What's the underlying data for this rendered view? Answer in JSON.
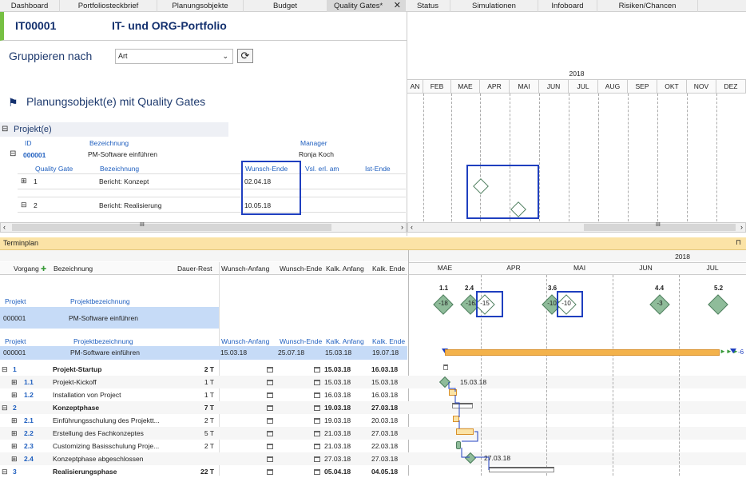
{
  "tabs": [
    {
      "label": "Dashboard"
    },
    {
      "label": "Portfoliosteckbrief"
    },
    {
      "label": "Planungsobjekte"
    },
    {
      "label": "Budget"
    },
    {
      "label": "Quality Gates*"
    },
    {
      "label": "Status"
    },
    {
      "label": "Simulationen"
    },
    {
      "label": "Infoboard"
    },
    {
      "label": "Risiken/Chancen"
    }
  ],
  "header": {
    "id": "IT00001",
    "title": "IT- und ORG-Portfolio"
  },
  "group": {
    "label": "Gruppieren nach",
    "value": "Art",
    "refresh_icon": "refresh-icon"
  },
  "section": {
    "title": "Planungsobjekt(e) mit Quality Gates",
    "icon": "flag-icon"
  },
  "projekte": {
    "group_label": "Projekt(e)",
    "col_id": "ID",
    "col_bez": "Bezeichnung",
    "col_manager": "Manager",
    "id": "000001",
    "bez": "PM-Software einführen",
    "manager": "Ronja Koch"
  },
  "qg": {
    "headers": {
      "gate": "Quality Gate",
      "bez": "Bezeichnung",
      "wunsch": "Wunsch-Ende",
      "vsl": "Vsl. erl. am",
      "ist": "Ist-Ende"
    },
    "rows": [
      {
        "gate": "1",
        "bez": "Bericht: Konzept",
        "wunsch": "02.04.18"
      },
      {
        "gate": "2",
        "bez": "Bericht: Realisierung",
        "wunsch": "10.05.18"
      }
    ]
  },
  "timeline_top": {
    "year": "2018",
    "months": [
      "AN",
      "FEB",
      "MAE",
      "APR",
      "MAI",
      "JUN",
      "JUL",
      "AUG",
      "SEP",
      "OKT",
      "NOV",
      "DEZ"
    ]
  },
  "scroll_glyph": "III",
  "terminplan": {
    "title": "Terminplan",
    "pin": "⊓",
    "headers": {
      "vorgang": "Vorgang",
      "bez": "Bezeichnung",
      "dauer": "Dauer-Rest",
      "wanf": "Wunsch-Anfang",
      "wend": "Wunsch-Ende",
      "kanf": "Kalk. Anfang",
      "kend": "Kalk. Ende"
    },
    "proj_label": "Projekt",
    "projbez_label": "Projektbezeichnung",
    "proj_id": "000001",
    "proj_bez": "PM-Software einführen",
    "proj_row": {
      "wanf": "15.03.18",
      "wend": "25.07.18",
      "kanf": "15.03.18",
      "kend": "19.07.18"
    },
    "rows": [
      {
        "v": "1",
        "bez": "Projekt-Startup",
        "dauer": "2 T",
        "kanf": "15.03.18",
        "kend": "16.03.18",
        "bold": true
      },
      {
        "v": "1.1",
        "bez": "Projekt-Kickoff",
        "dauer": "1 T",
        "kanf": "15.03.18",
        "kend": "15.03.18",
        "bold": false
      },
      {
        "v": "1.2",
        "bez": "Installation von Project",
        "dauer": "1 T",
        "kanf": "16.03.18",
        "kend": "16.03.18",
        "bold": false
      },
      {
        "v": "2",
        "bez": "Konzeptphase",
        "dauer": "7 T",
        "kanf": "19.03.18",
        "kend": "27.03.18",
        "bold": true
      },
      {
        "v": "2.1",
        "bez": "Einführungsschulung des Projektt...",
        "dauer": "2 T",
        "kanf": "19.03.18",
        "kend": "20.03.18",
        "bold": false
      },
      {
        "v": "2.2",
        "bez": "Erstellung des Fachkonzeptes",
        "dauer": "5 T",
        "kanf": "21.03.18",
        "kend": "27.03.18",
        "bold": false
      },
      {
        "v": "2.3",
        "bez": "Customizing Basisschulung Proje...",
        "dauer": "2 T",
        "kanf": "21.03.18",
        "kend": "22.03.18",
        "bold": false
      },
      {
        "v": "2.4",
        "bez": "Konzeptphase abgeschlossen",
        "dauer": "",
        "kanf": "27.03.18",
        "kend": "27.03.18",
        "bold": false
      },
      {
        "v": "3",
        "bez": "Realisierungsphase",
        "dauer": "22 T",
        "kanf": "05.04.18",
        "kend": "04.05.18",
        "bold": true
      }
    ],
    "gantt_year": "2018",
    "gantt_months": [
      "MAE",
      "APR",
      "MAI",
      "JUN",
      "JUL"
    ],
    "milestones": [
      {
        "label": "1.1",
        "val": "-18"
      },
      {
        "label": "2.4",
        "val": "-16"
      },
      {
        "label": "",
        "val": "-15"
      },
      {
        "label": "3.6",
        "val": "-10"
      },
      {
        "label": "",
        "val": "-10"
      },
      {
        "label": "4.4",
        "val": "-3"
      },
      {
        "label": "5.2",
        "val": ""
      }
    ],
    "bar_end_label": "-6",
    "ms_label_1": "15.03.18",
    "ms_label_2": "27.03.18"
  },
  "colors": {
    "accent_green": "#76c043",
    "title_blue": "#13306e",
    "link_blue": "#1f5fbf",
    "highlight": "#c6dbf7",
    "terminplan_bar": "#fbe3a6",
    "diamond": "#8fbc9a",
    "box": "#1f3fbf"
  }
}
